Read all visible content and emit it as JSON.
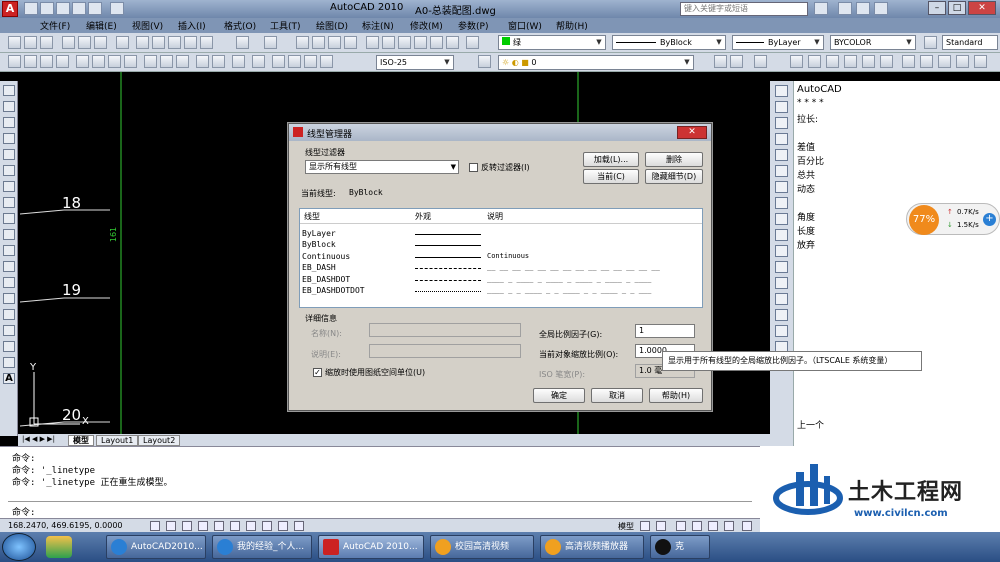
{
  "window": {
    "title": "AutoCAD 2010",
    "filename": "A0-总装配图.dwg",
    "search_placeholder": "键入关键字或短语",
    "app_icon_letter": "A"
  },
  "menu": [
    "文件(F)",
    "编辑(E)",
    "视图(V)",
    "插入(I)",
    "格式(O)",
    "工具(T)",
    "绘图(D)",
    "标注(N)",
    "修改(M)",
    "参数(P)",
    "窗口(W)",
    "帮助(H)"
  ],
  "toolbar": {
    "layer": "绿",
    "linetype1": "ByBlock",
    "linetype2": "ByLayer",
    "color": "BYCOLOR",
    "textstyle": "Standard",
    "dimstyle": "ISO-25",
    "layer_num": "0"
  },
  "canvas": {
    "label_18": "18",
    "label_19": "19",
    "label_20": "20",
    "ucs_y": "Y",
    "ucs_x": "X",
    "vertical_text": "161"
  },
  "right_panel": {
    "title": "AutoCAD",
    "stars": "* * * *",
    "items": [
      "拉长:",
      "差值",
      "百分比",
      "总共",
      "动态",
      "角度",
      "长度",
      "放弃",
      "上一个"
    ]
  },
  "net_widget": {
    "percent": "77%",
    "up": "0.7K/s",
    "down": "1.5K/s"
  },
  "dialog": {
    "title": "线型管理器",
    "close": "✕",
    "filter_label": "线型过滤器",
    "filter_value": "显示所有线型",
    "invert_label": "反转过滤器(I)",
    "btn_load": "加载(L)...",
    "btn_delete": "删除",
    "btn_current": "当前(C)",
    "btn_hide": "隐藏细节(D)",
    "current_label": "当前线型:",
    "current_value": "ByBlock",
    "col_linetype": "线型",
    "col_appearance": "外观",
    "col_description": "说明",
    "rows": [
      {
        "name": "ByLayer",
        "desc": ""
      },
      {
        "name": "ByBlock",
        "desc": ""
      },
      {
        "name": "Continuous",
        "desc": "Continuous"
      },
      {
        "name": "EB_DASH",
        "desc": "__ __ __ __ __ __ __ __ __ __ __ __ __ __"
      },
      {
        "name": "EB_DASHDOT",
        "desc": "____ _ ____ _ ____ _ ____ _ ____ _ ____"
      },
      {
        "name": "EB_DASHDOTDOT",
        "desc": "____ _ _ ____ _ _ ____ _ _ ____ _ _ ___"
      }
    ],
    "details_label": "详细信息",
    "name_label": "名称(N):",
    "desc_label": "说明(E):",
    "paper_units_label": "缩放时使用图纸空间单位(U)",
    "global_scale_label": "全局比例因子(G):",
    "global_scale_value": "1",
    "current_scale_label": "当前对象缩放比例(O):",
    "current_scale_value": "1.0000",
    "iso_pen_label": "ISO 笔宽(P):",
    "iso_pen_value": "1.0 毫",
    "btn_ok": "确定",
    "btn_cancel": "取消",
    "btn_help": "帮助(H)"
  },
  "tooltip": "显示用于所有线型的全局缩放比例因子。（LTSCALE 系统变量）",
  "tabs": [
    "模型",
    "Layout1",
    "Layout2"
  ],
  "command_lines": [
    "命令:",
    "命令: '_linetype",
    "命令: '_linetype 正在重生成模型。",
    "",
    "命令:"
  ],
  "status": {
    "coords": "168.2470,  469.6195,  0.0000",
    "model": "模型"
  },
  "logo": {
    "brand": "土木工程网",
    "url": "www.civilcn.com"
  },
  "taskbar": [
    {
      "label": "AutoCAD2010...",
      "color": "#2a7fd4"
    },
    {
      "label": "我的经验_个人...",
      "color": "#2a7fd4"
    },
    {
      "label": "AutoCAD 2010...",
      "color": "#c22"
    },
    {
      "label": "校园高清视频",
      "color": "#f0a020"
    },
    {
      "label": "高清视频播放器",
      "color": "#f0a020"
    },
    {
      "label": "克",
      "color": "#111"
    }
  ]
}
